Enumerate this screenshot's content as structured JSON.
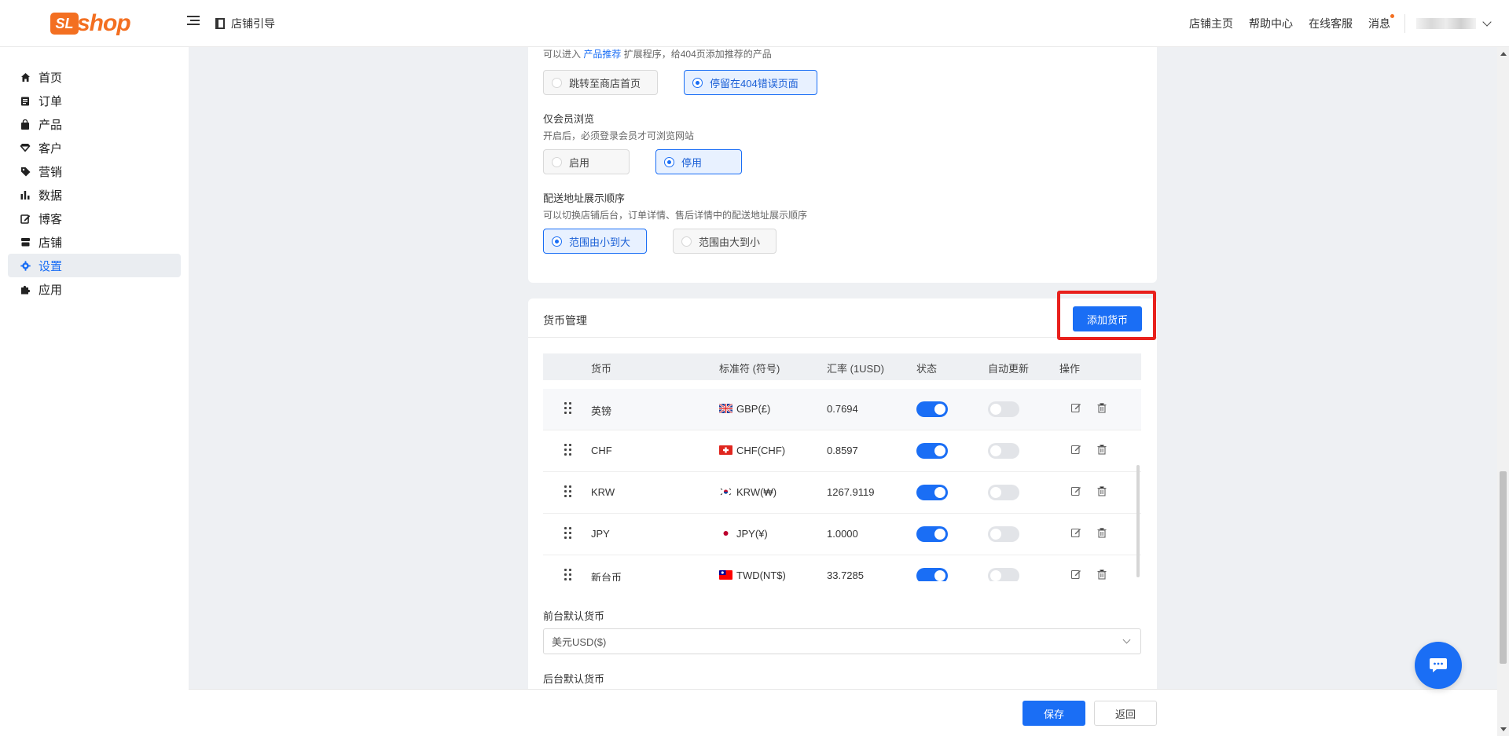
{
  "header": {
    "logo_mark": "SL",
    "logo_text": "shop",
    "guide_label": "店铺引导",
    "links": [
      "店铺主页",
      "帮助中心",
      "在线客服",
      "消息"
    ]
  },
  "sidebar": {
    "items": [
      {
        "label": "首页",
        "icon": "home-icon"
      },
      {
        "label": "订单",
        "icon": "clipboard-icon"
      },
      {
        "label": "产品",
        "icon": "bag-icon"
      },
      {
        "label": "客户",
        "icon": "diamond-icon"
      },
      {
        "label": "营销",
        "icon": "tag-icon"
      },
      {
        "label": "数据",
        "icon": "bar-chart-icon"
      },
      {
        "label": "博客",
        "icon": "edit-icon"
      },
      {
        "label": "店铺",
        "icon": "store-icon"
      },
      {
        "label": "设置",
        "icon": "gear-icon",
        "active": true
      },
      {
        "label": "应用",
        "icon": "puzzle-icon"
      }
    ]
  },
  "settings": {
    "page404": {
      "hint_prefix": "可以进入",
      "hint_link": "产品推荐",
      "hint_suffix": "扩展程序，给404页添加推荐的产品",
      "options": [
        "跳转至商店首页",
        "停留在404错误页面"
      ],
      "selected": 1
    },
    "member_only": {
      "title": "仅会员浏览",
      "hint": "开启后，必须登录会员才可浏览网站",
      "options": [
        "启用",
        "停用"
      ],
      "selected": 1
    },
    "address_order": {
      "title": "配送地址展示顺序",
      "hint": "可以切换店铺后台，订单详情、售后详情中的配送地址展示顺序",
      "options": [
        "范围由小到大",
        "范围由大到小"
      ],
      "selected": 0
    }
  },
  "currency": {
    "title": "货币管理",
    "add_button": "添加货币",
    "columns": [
      "货币",
      "标准符 (符号)",
      "汇率 (1USD)",
      "状态",
      "自动更新",
      "操作"
    ],
    "rows": [
      {
        "name": "英镑",
        "code": "GBP(£)",
        "rate": "0.7694",
        "status": true,
        "auto": false,
        "flag": "uk"
      },
      {
        "name": "CHF",
        "code": "CHF(CHF)",
        "rate": "0.8597",
        "status": true,
        "auto": false,
        "flag": "ch"
      },
      {
        "name": "KRW",
        "code": "KRW(₩)",
        "rate": "1267.9119",
        "status": true,
        "auto": false,
        "flag": "kr"
      },
      {
        "name": "JPY",
        "code": "JPY(¥)",
        "rate": "1.0000",
        "status": true,
        "auto": false,
        "flag": "jp"
      },
      {
        "name": "新台币",
        "code": "TWD(NT$)",
        "rate": "33.7285",
        "status": true,
        "auto": false,
        "flag": "tw"
      }
    ],
    "front_default_label": "前台默认货币",
    "front_default_value": "美元USD($)",
    "back_default_label": "后台默认货币"
  },
  "footer": {
    "save": "保存",
    "back": "返回"
  },
  "colors": {
    "accent": "#1a6ef5",
    "brand": "#f36f21",
    "highlight": "#e8201c"
  }
}
